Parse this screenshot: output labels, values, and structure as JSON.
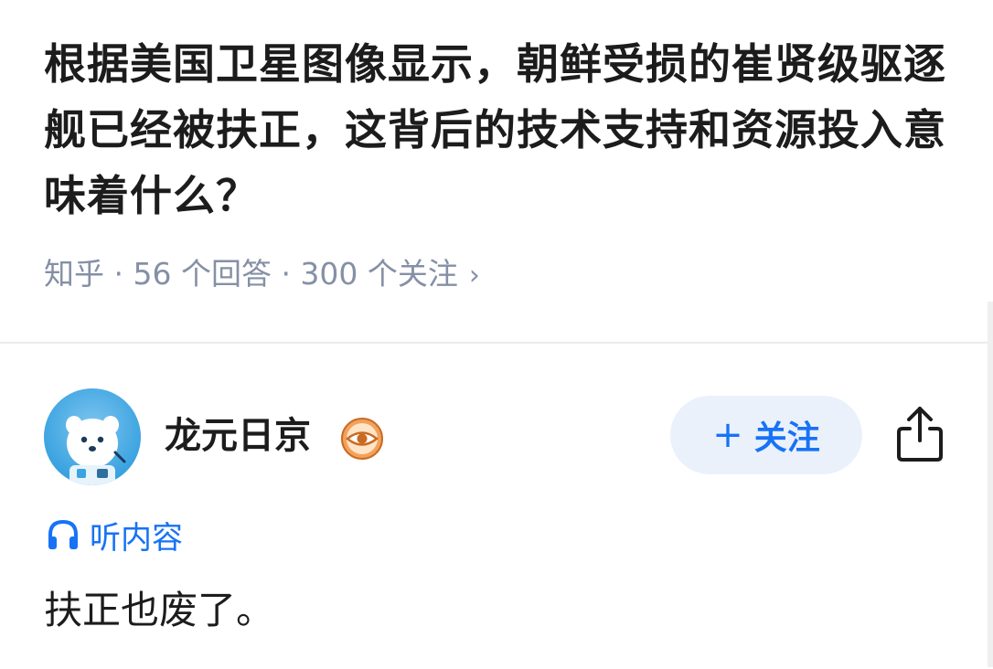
{
  "question": {
    "title": "根据美国卫星图像显示，朝鲜受损的崔贤级驱逐舰已经被扶正，这背后的技术支持和资源投入意味着什么？",
    "meta": "知乎 · 56 个回答 · 300 个关注",
    "meta_chevron": "›"
  },
  "answer": {
    "author": {
      "name": "龙元日京",
      "avatar_icon": "cartoon-bear-avatar",
      "badge_icon": "eye-badge-icon"
    },
    "follow_button": {
      "plus": "+",
      "label": "关注"
    },
    "share_icon": "share-icon",
    "listen": {
      "icon": "headphones-icon",
      "label": "听内容"
    },
    "content": "扶正也废了。"
  },
  "colors": {
    "accent": "#1772f6",
    "meta_gray": "#8590a6",
    "follow_bg": "#eaf1fb",
    "badge_orange": "#f08a3c"
  }
}
